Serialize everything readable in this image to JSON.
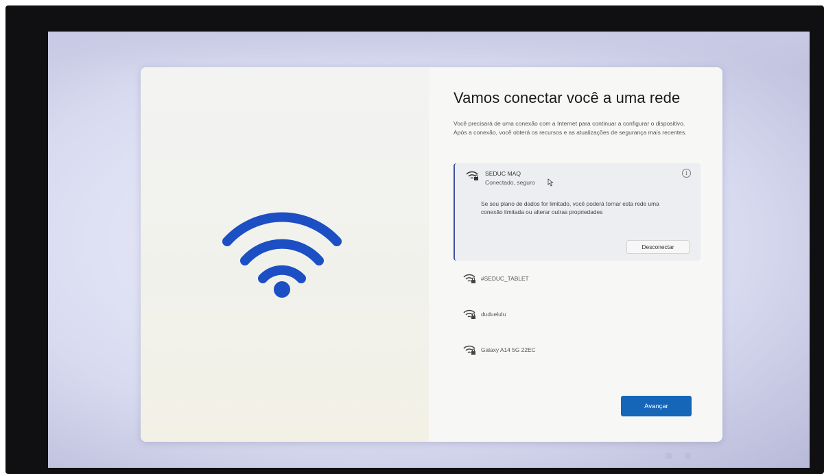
{
  "page": {
    "title": "Vamos conectar você a uma rede",
    "description": "Você precisará de uma conexão com a Internet para continuar a configurar o dispositivo. Após a conexão, você obterá os recursos e as atualizações de segurança mais recentes."
  },
  "networks": {
    "selected": {
      "name": "SEDUC MAQ",
      "status": "Conectado, seguro",
      "note": "Se seu plano de dados for limitado, você poderá tornar esta rede uma conexão limitada ou alterar outras propriedades",
      "disconnect_label": "Desconectar",
      "info_icon": "i"
    },
    "others": [
      {
        "name": "#SEDUC_TABLET"
      },
      {
        "name": "duduelulu"
      },
      {
        "name": "Galaxy A14 5G 22EC"
      }
    ]
  },
  "actions": {
    "next_label": "Avançar"
  },
  "colors": {
    "accent": "#1565b8",
    "wifi_hero": "#1c4fc4",
    "selected_bar": "#3f52a3"
  }
}
